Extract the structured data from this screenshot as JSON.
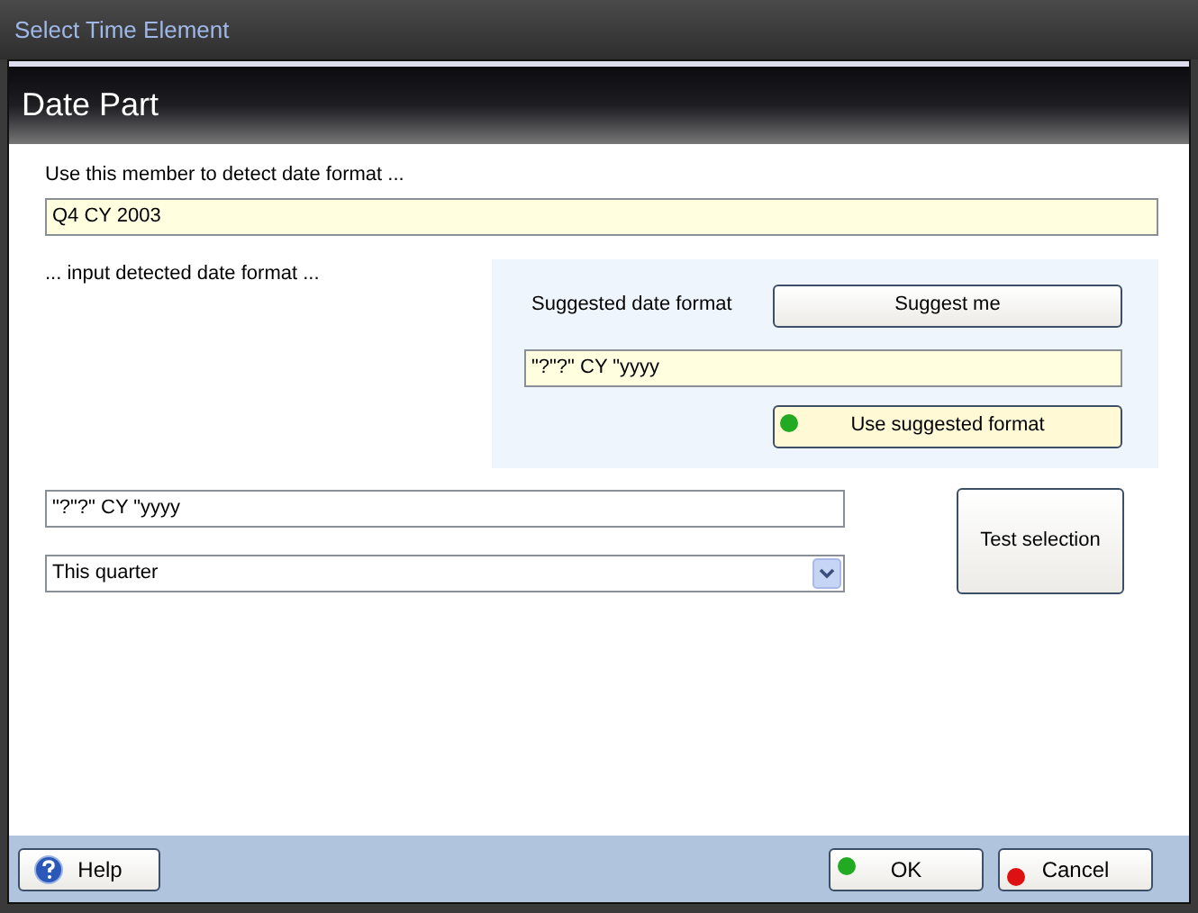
{
  "window": {
    "title": "Select Time Element"
  },
  "header": {
    "title": "Date Part"
  },
  "member": {
    "label": "Use this member to detect date format ...",
    "value": "Q4 CY 2003"
  },
  "detected_label": "... input detected date format ...",
  "suggest_panel": {
    "label": "Suggested date format",
    "suggest_button": "Suggest me",
    "value": "\"?\"?\" CY \"yyyy",
    "use_button": {
      "label": "Use suggested format",
      "color": "#22aa22"
    }
  },
  "format_field": {
    "value": "\"?\"?\" CY \"yyyy"
  },
  "period_select": {
    "value": "This quarter"
  },
  "test_button": "Test selection",
  "footer_buttons": [
    {
      "kind": "help",
      "label": "Help"
    },
    {
      "kind": "dot",
      "label": "OK",
      "color": "#22aa22"
    },
    {
      "kind": "dot",
      "label": "Cancel",
      "color": "#dd1111"
    }
  ]
}
